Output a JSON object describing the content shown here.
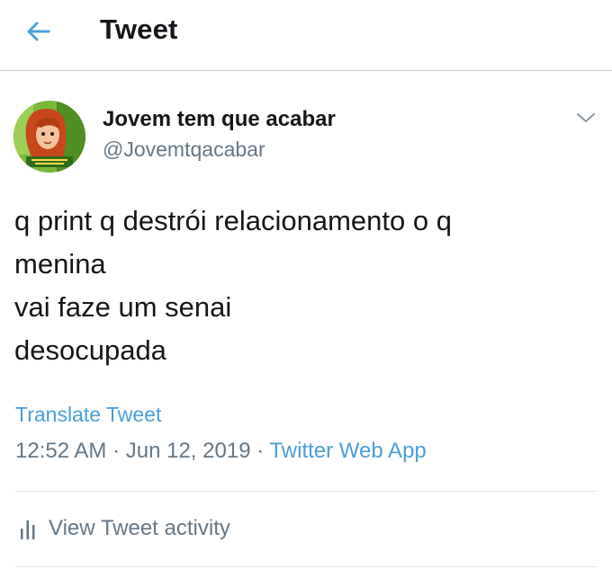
{
  "header": {
    "title": "Tweet",
    "back_icon": "arrow-left-icon",
    "accent_color": "#4a9fd8"
  },
  "tweet": {
    "display_name": "Jovem tem que acabar",
    "handle": "@Jovemtqacabar",
    "menu_icon": "chevron-down-icon",
    "text_lines": [
      "q print q destrói relacionamento o q",
      "menina",
      "vai faze um senai",
      "desocupada"
    ],
    "translate_label": "Translate Tweet",
    "time": "12:52 AM",
    "separator": "·",
    "date": "Jun 12, 2019",
    "source": "Twitter Web App",
    "activity_icon": "bar-chart-icon",
    "activity_label": "View Tweet activity"
  }
}
